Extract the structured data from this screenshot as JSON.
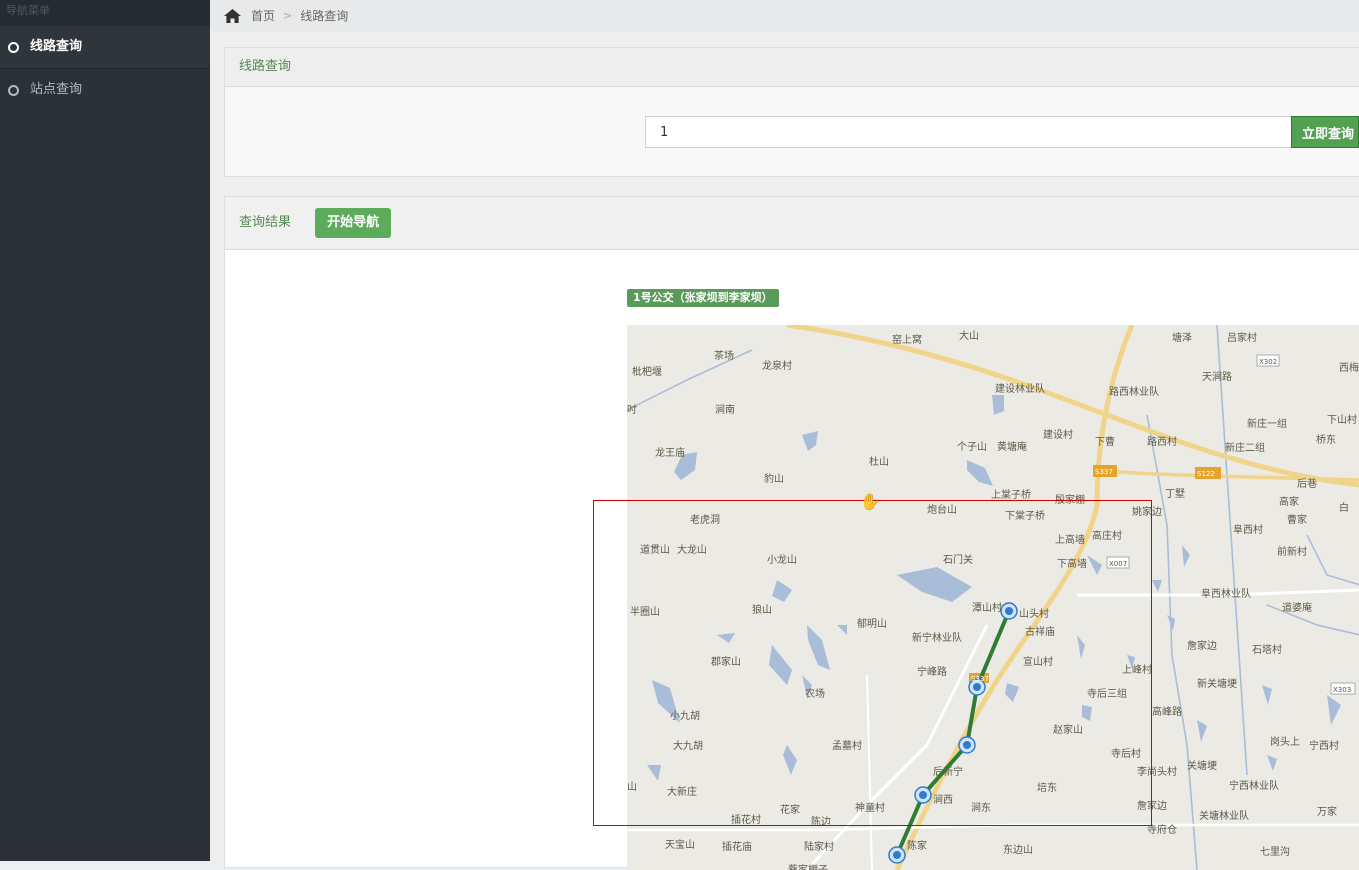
{
  "sidebar": {
    "title": "导航菜单",
    "items": [
      {
        "label": "线路查询",
        "active": true
      },
      {
        "label": "站点查询",
        "active": false
      }
    ]
  },
  "breadcrumb": {
    "home": "首页",
    "separator": ">",
    "current": "线路查询"
  },
  "search_panel": {
    "title": "线路查询",
    "input_value": "1",
    "button_label": "立即查询"
  },
  "result_panel": {
    "title": "查询结果",
    "navigate_label": "开始导航",
    "route_title": "1号公交（张家坝到李家坝）"
  },
  "map": {
    "labels": [
      {
        "t": "窑上窝"
      },
      {
        "t": "茶场"
      },
      {
        "t": "龙泉村"
      },
      {
        "t": "枇杷堰"
      },
      {
        "t": "涧南"
      },
      {
        "t": "建设林业队"
      },
      {
        "t": "路西林业队"
      },
      {
        "t": "天涧路"
      },
      {
        "t": "新庄一组"
      },
      {
        "t": "下山村"
      },
      {
        "t": "新庄二组"
      },
      {
        "t": "桥东"
      },
      {
        "t": "龙王庙"
      },
      {
        "t": "杜山"
      },
      {
        "t": "豹山"
      },
      {
        "t": "个子山"
      },
      {
        "t": "黄塘庵"
      },
      {
        "t": "建设村"
      },
      {
        "t": "下曹"
      },
      {
        "t": "路西村"
      },
      {
        "t": "后巷"
      },
      {
        "t": "高家"
      },
      {
        "t": "曹家"
      },
      {
        "t": "丁墅"
      },
      {
        "t": "上棠子桥"
      },
      {
        "t": "下棠子桥"
      },
      {
        "t": "殷家棚"
      },
      {
        "t": "姚家边"
      },
      {
        "t": "炮台山"
      },
      {
        "t": "老虎洞"
      },
      {
        "t": "道贯山"
      },
      {
        "t": "大龙山"
      },
      {
        "t": "小龙山"
      },
      {
        "t": "石门关"
      },
      {
        "t": "上高墙"
      },
      {
        "t": "高庄村"
      },
      {
        "t": "下高墙"
      },
      {
        "t": "阜西村"
      },
      {
        "t": "前新村"
      },
      {
        "t": "半圈山"
      },
      {
        "t": "狼山"
      },
      {
        "t": "郁明山"
      },
      {
        "t": "潭山村"
      },
      {
        "t": "山头村"
      },
      {
        "t": "古祥庙"
      },
      {
        "t": "阜西林业队"
      },
      {
        "t": "道婆庵"
      },
      {
        "t": "新宁林业队"
      },
      {
        "t": "郡家山"
      },
      {
        "t": "宁峰路"
      },
      {
        "t": "宣山村"
      },
      {
        "t": "詹家边"
      },
      {
        "t": "石塔村"
      },
      {
        "t": "上峰村"
      },
      {
        "t": "农场"
      },
      {
        "t": "寺后三组"
      },
      {
        "t": "高峰路"
      },
      {
        "t": "新关塘埂"
      },
      {
        "t": "小九胡"
      },
      {
        "t": "大九胡"
      },
      {
        "t": "孟墓村"
      },
      {
        "t": "赵家山"
      },
      {
        "t": "岗头上"
      },
      {
        "t": "宁西村"
      },
      {
        "t": "寺后村"
      },
      {
        "t": "后新宁"
      },
      {
        "t": "李尚头村"
      },
      {
        "t": "关塘埂"
      },
      {
        "t": "大新庄"
      },
      {
        "t": "培东"
      },
      {
        "t": "宁西林业队"
      },
      {
        "t": "花家"
      },
      {
        "t": "神童村"
      },
      {
        "t": "涧西"
      },
      {
        "t": "涧东"
      },
      {
        "t": "詹家边"
      },
      {
        "t": "关塘林业队"
      },
      {
        "t": "万家"
      },
      {
        "t": "插花村"
      },
      {
        "t": "陈边"
      },
      {
        "t": "寺府仓"
      },
      {
        "t": "天宝山"
      },
      {
        "t": "插花庙"
      },
      {
        "t": "陆家村"
      },
      {
        "t": "陈家"
      },
      {
        "t": "东边山"
      },
      {
        "t": "七里沟"
      },
      {
        "t": "蔡家棚子"
      },
      {
        "t": "山"
      },
      {
        "t": "吋"
      },
      {
        "t": "西梅"
      },
      {
        "t": "吕家村"
      },
      {
        "t": "塘泽"
      },
      {
        "t": "大山"
      },
      {
        "t": "白"
      }
    ],
    "shields": [
      "S337",
      "S122",
      "X302",
      "X007",
      "X303",
      "S337"
    ]
  },
  "colors": {
    "sidebar_bg": "#2b3137",
    "accent_green": "#53a053",
    "route_line": "#2f7d32",
    "highlight_box": "#d00000"
  }
}
